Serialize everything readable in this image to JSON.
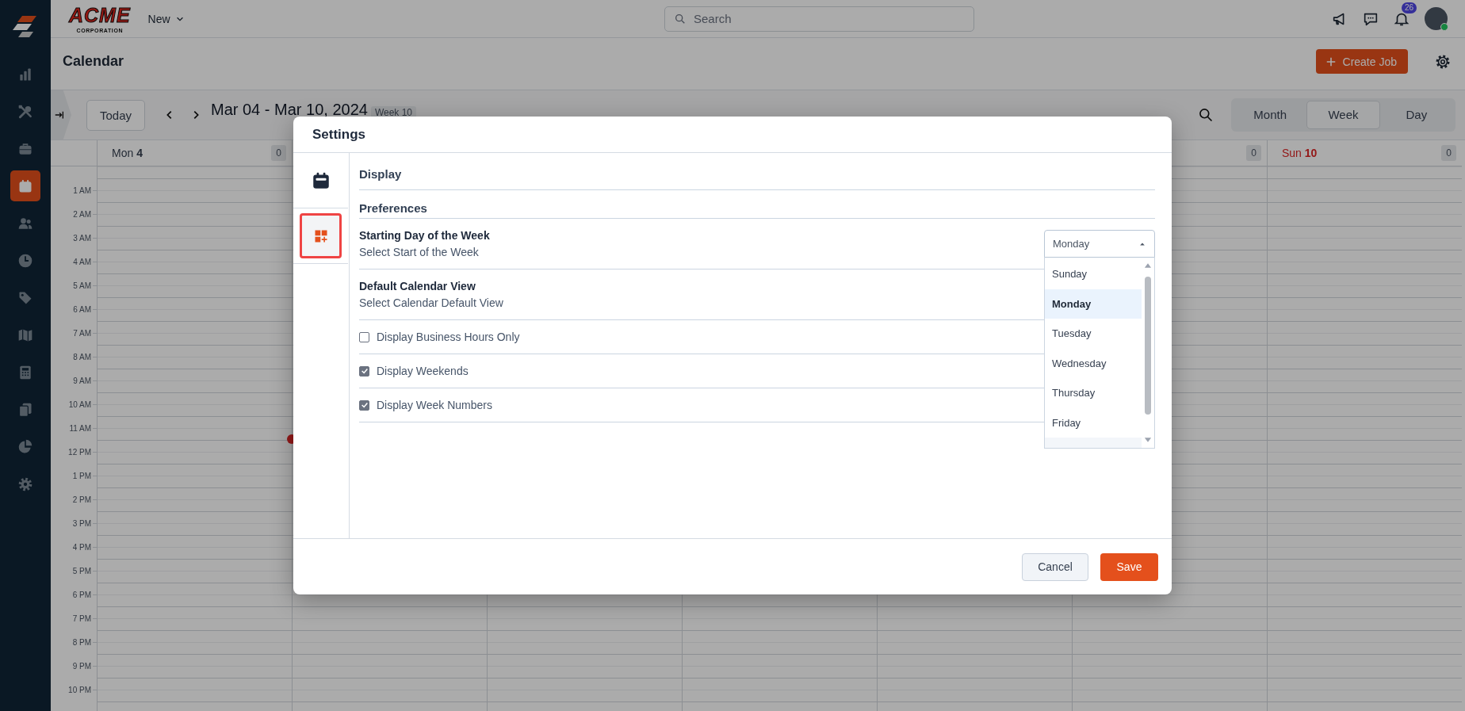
{
  "sidebar": {
    "items": [
      {
        "kind": "chart",
        "selected": false
      },
      {
        "kind": "tools",
        "selected": false
      },
      {
        "kind": "briefcase",
        "selected": false
      },
      {
        "kind": "calendar",
        "selected": true
      },
      {
        "kind": "people",
        "selected": false
      },
      {
        "kind": "clock",
        "selected": false
      },
      {
        "kind": "tag",
        "selected": false
      },
      {
        "kind": "map",
        "selected": false
      },
      {
        "kind": "calculator",
        "selected": false
      },
      {
        "kind": "documents",
        "selected": false
      },
      {
        "kind": "pie",
        "selected": false
      },
      {
        "kind": "settings",
        "selected": false
      }
    ]
  },
  "topbar": {
    "logo": {
      "wordmark": "ACME",
      "tagline": "CORPORATION"
    },
    "new_menu": "New",
    "search": {
      "placeholder": "Search"
    },
    "notification_count": "26"
  },
  "header": {
    "title": "Calendar",
    "create_button": "Create Job"
  },
  "toolbar": {
    "today_button": "Today",
    "date_range": "Mar 04 - Mar 10, 2024",
    "week_badge": "Week 10",
    "views": [
      {
        "label": "Month",
        "selected": false
      },
      {
        "label": "Week",
        "selected": true
      },
      {
        "label": "Day",
        "selected": false
      }
    ]
  },
  "calendar": {
    "days": [
      {
        "name": "Mon",
        "date": "4",
        "count": "0",
        "weekend": false
      },
      {
        "count": "0"
      },
      {
        "name": "Sun",
        "date": "10",
        "count": "0",
        "weekend": true
      }
    ],
    "time_labels": [
      "1 AM",
      "2 AM",
      "3 AM",
      "4 AM",
      "5 AM",
      "6 AM",
      "7 AM",
      "8 AM",
      "9 AM",
      "10 AM",
      "11 AM",
      "12 PM",
      "1 PM",
      "2 PM",
      "3 PM",
      "4 PM",
      "5 PM",
      "6 PM",
      "7 PM",
      "8 PM",
      "9 PM",
      "10 PM"
    ]
  },
  "modal": {
    "title": "Settings",
    "tabs": [
      {
        "kind": "calendar",
        "selected": false
      },
      {
        "kind": "grid-plus",
        "selected": true
      }
    ],
    "section": "Display",
    "subsection": "Preferences",
    "settings": [
      {
        "kind": "select",
        "title": "Starting Day of the Week",
        "subtitle": "Select Start of the Week",
        "value": "Monday",
        "expanded": true,
        "options": [
          {
            "label": "Sunday",
            "selected": false
          },
          {
            "label": "Monday",
            "selected": true
          },
          {
            "label": "Tuesday",
            "selected": false
          },
          {
            "label": "Wednesday",
            "selected": false
          },
          {
            "label": "Thursday",
            "selected": false
          },
          {
            "label": "Friday",
            "selected": false
          }
        ]
      },
      {
        "kind": "select",
        "title": "Default Calendar View",
        "subtitle": "Select Calendar Default View"
      },
      {
        "kind": "checkbox",
        "label": "Display Business Hours Only",
        "checked": false
      },
      {
        "kind": "checkbox",
        "label": "Display Weekends",
        "checked": true
      },
      {
        "kind": "checkbox",
        "label": "Display Week Numbers",
        "checked": true
      }
    ],
    "cancel_button": "Cancel",
    "save_button": "Save"
  }
}
